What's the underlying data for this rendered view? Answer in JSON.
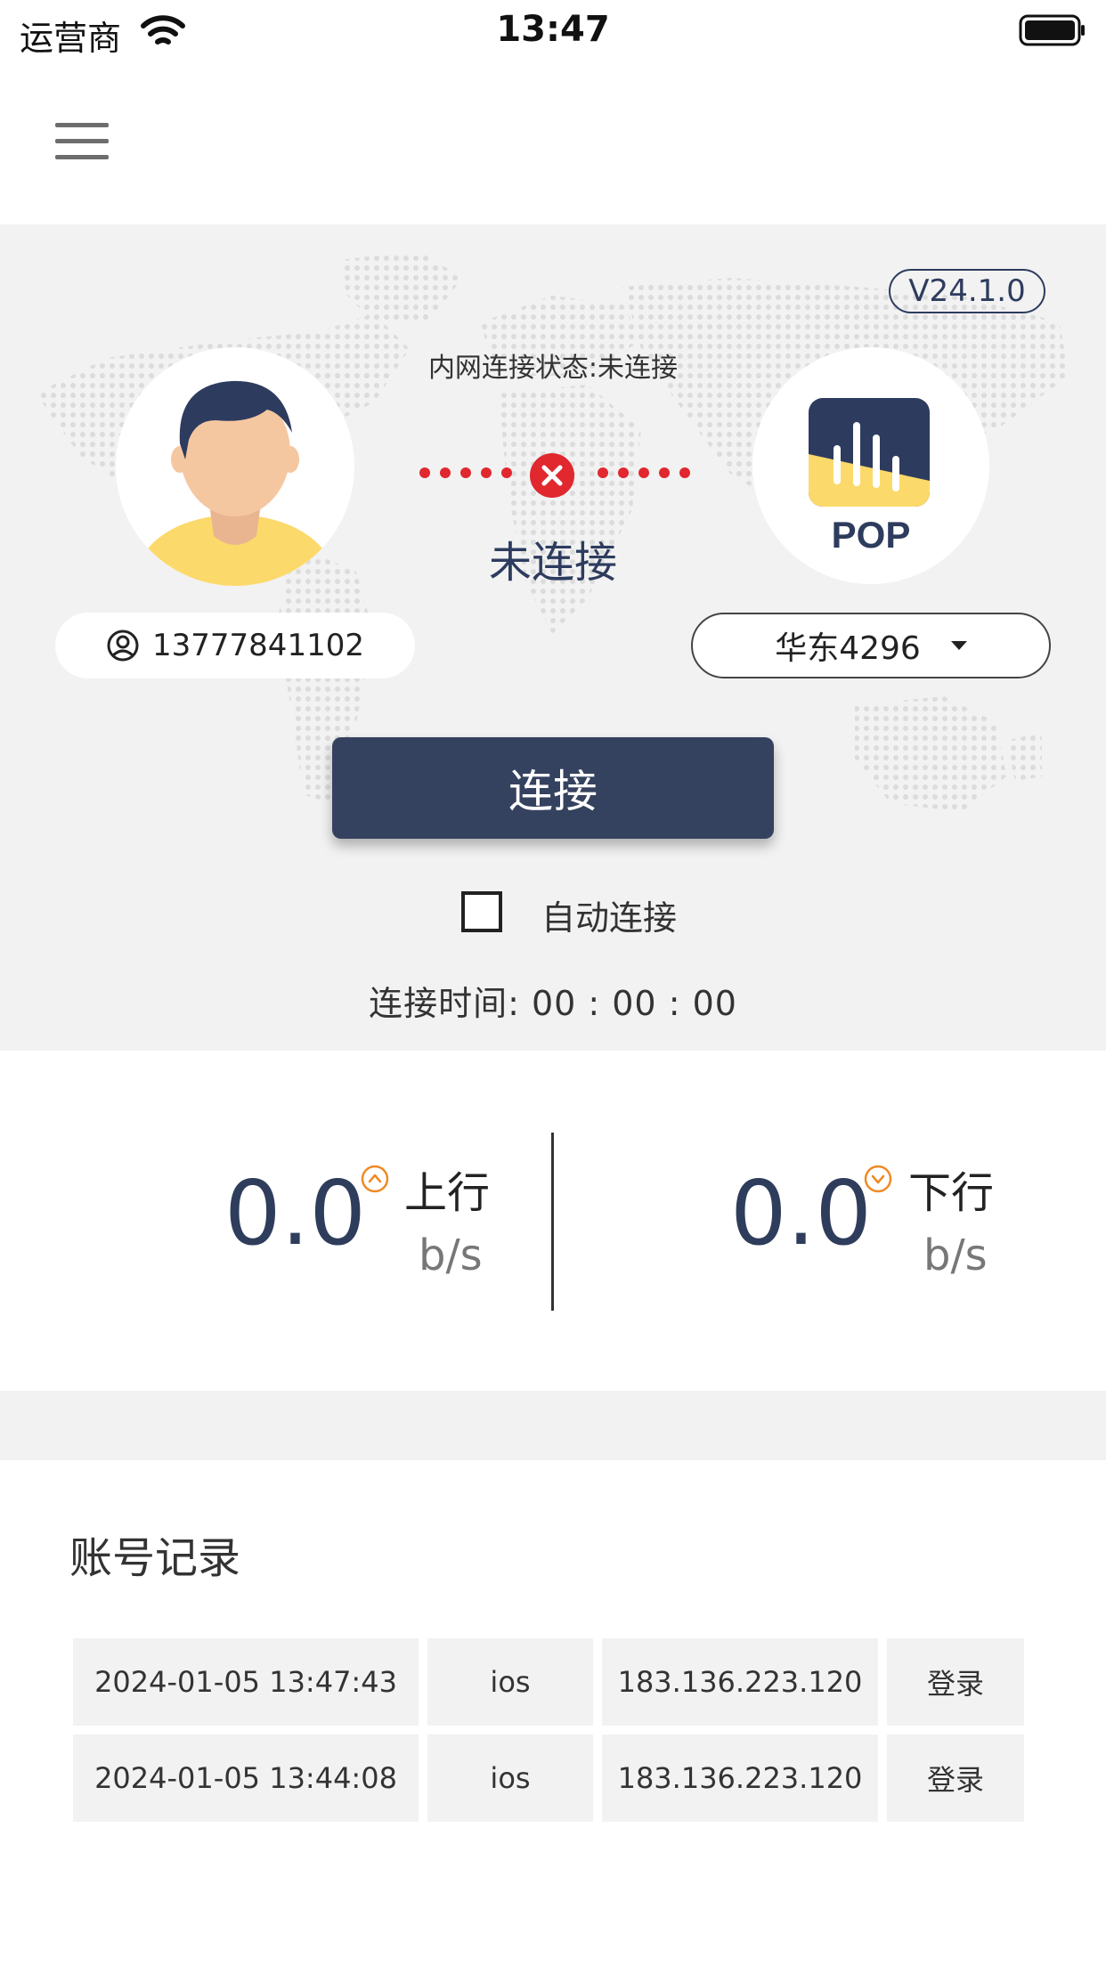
{
  "status_bar": {
    "carrier": "运营商",
    "time": "13:47"
  },
  "panel": {
    "version": "V24.1.0",
    "intranet_status": "内网连接状态:未连接",
    "connection_state": "未连接",
    "account": "13777841102",
    "server": "华东4296",
    "pop_label": "POP",
    "connect_button": "连接",
    "auto_connect_label": "自动连接",
    "auto_connect_checked": false,
    "connection_time": "连接时间: 00 : 00 : 00"
  },
  "speed": {
    "upload": {
      "value": "0.0",
      "label": "上行",
      "unit": "b/s"
    },
    "download": {
      "value": "0.0",
      "label": "下行",
      "unit": "b/s"
    }
  },
  "records": {
    "title": "账号记录",
    "rows": [
      {
        "time": "2024-01-05 13:47:43",
        "platform": "ios",
        "ip": "183.136.223.120",
        "action": "登录"
      },
      {
        "time": "2024-01-05 13:44:08",
        "platform": "ios",
        "ip": "183.136.223.120",
        "action": "登录"
      }
    ]
  },
  "colors": {
    "accent": "#35425f",
    "panel_bg": "#f2f2f2",
    "error": "#e0282e",
    "speed_arrow": "#f08a24",
    "pop_yellow": "#fcd96b"
  }
}
